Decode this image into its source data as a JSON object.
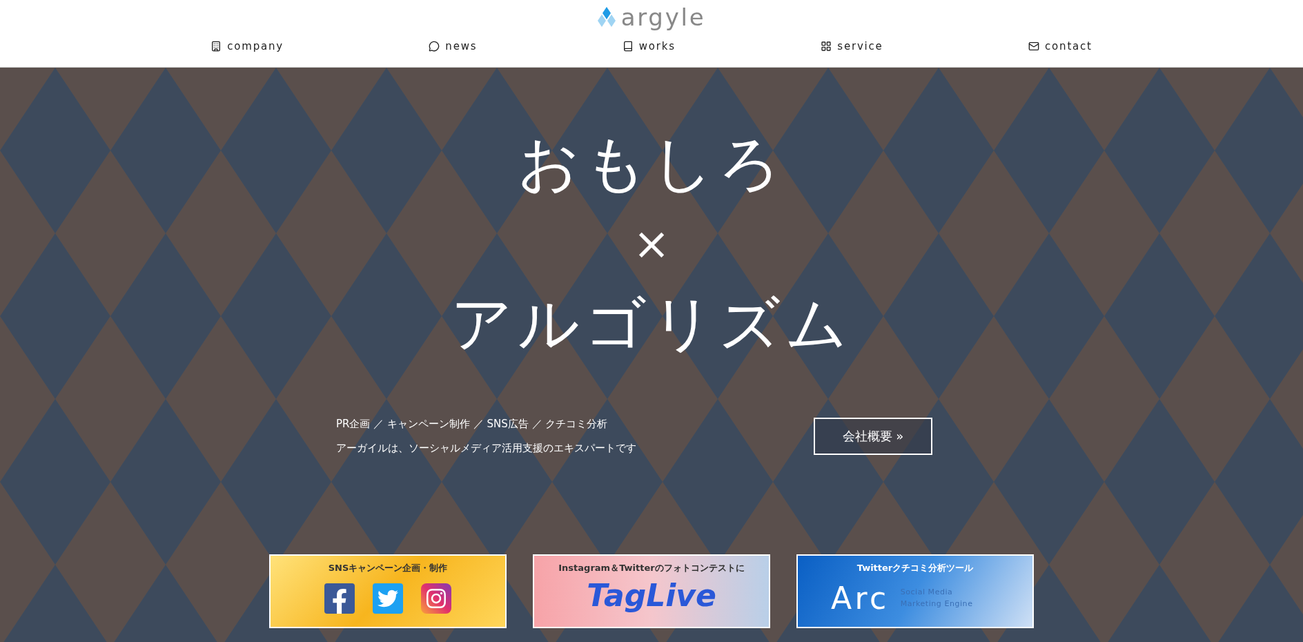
{
  "header": {
    "logo": "argyle",
    "nav": [
      {
        "label": "company",
        "kind": "building"
      },
      {
        "label": "news",
        "kind": "chat"
      },
      {
        "label": "works",
        "kind": "book"
      },
      {
        "label": "service",
        "kind": "grid"
      },
      {
        "label": "contact",
        "kind": "mail"
      }
    ]
  },
  "hero": {
    "headline": [
      "おもしろ",
      "×",
      "アルゴリズム"
    ],
    "tagline": [
      "PR企画 ／ キャンペーン制作 ／ SNS広告 ／ クチコミ分析",
      "アーガイルは、ソーシャルメディア活用支援のエキスパートです"
    ],
    "button": "会社概要 »"
  },
  "banners": [
    {
      "kind": "social",
      "title": "SNSキャンペーン企画・制作"
    },
    {
      "kind": "taglive",
      "title": "Instagram＆Twitterのフォトコンテストに",
      "logo": "TagLive"
    },
    {
      "kind": "arc",
      "title": "Twitterクチコミ分析ツール",
      "logo": "Arc",
      "subtitle": [
        "Social Media",
        "Marketing Engine"
      ]
    }
  ]
}
